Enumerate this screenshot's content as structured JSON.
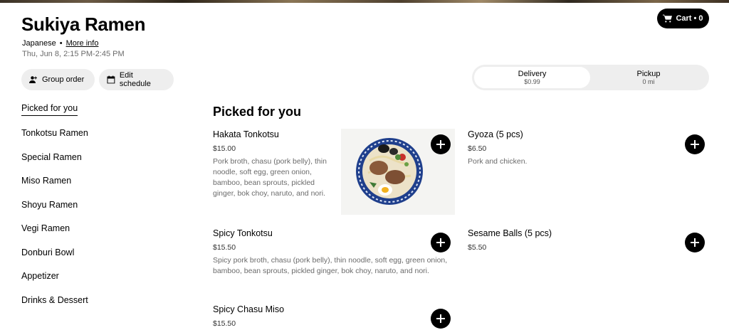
{
  "header": {
    "store_name": "Sukiya Ramen",
    "cuisine": "Japanese",
    "separator": "•",
    "more_info_label": "More info",
    "hours": "Thu, Jun 8, 2:15 PM-2:45 PM"
  },
  "cart": {
    "label": "Cart • 0",
    "icon": "cart-icon"
  },
  "actions": {
    "group_order_label": "Group order",
    "edit_schedule_label": "Edit schedule"
  },
  "mode_toggle": {
    "selected": "delivery",
    "delivery": {
      "label": "Delivery",
      "sub": "$0.99"
    },
    "pickup": {
      "label": "Pickup",
      "sub": "0 mi"
    }
  },
  "sidebar": {
    "items": [
      {
        "label": "Picked for you",
        "active": true
      },
      {
        "label": "Tonkotsu Ramen"
      },
      {
        "label": "Special Ramen"
      },
      {
        "label": "Miso Ramen"
      },
      {
        "label": "Shoyu Ramen"
      },
      {
        "label": "Vegi Ramen"
      },
      {
        "label": "Donburi Bowl"
      },
      {
        "label": "Appetizer"
      },
      {
        "label": "Drinks & Dessert"
      }
    ]
  },
  "main": {
    "section_title": "Picked for you",
    "items": [
      {
        "name": "Hakata Tonkotsu",
        "price": "$15.00",
        "description": "Pork broth, chasu (pork belly), thin noodle, soft egg, green onion, bamboo, bean sprouts, pickled ginger, bok choy, naruto, and nori."
      },
      {
        "name": "Gyoza (5 pcs)",
        "price": "$6.50",
        "description": "Pork and chicken."
      },
      {
        "name": "Spicy Tonkotsu",
        "price": "$15.50",
        "description": "Spicy pork broth, chasu (pork belly), thin noodle, soft egg, green onion, bamboo, bean sprouts, pickled ginger, bok choy, naruto, and nori."
      },
      {
        "name": "Sesame Balls (5 pcs)",
        "price": "$5.50"
      },
      {
        "name": "Spicy Chasu Miso",
        "price": "$15.50"
      }
    ]
  },
  "colors": {
    "primary": "#000000",
    "pill_bg": "#eeeeee",
    "muted_text": "#6b6b6b"
  }
}
